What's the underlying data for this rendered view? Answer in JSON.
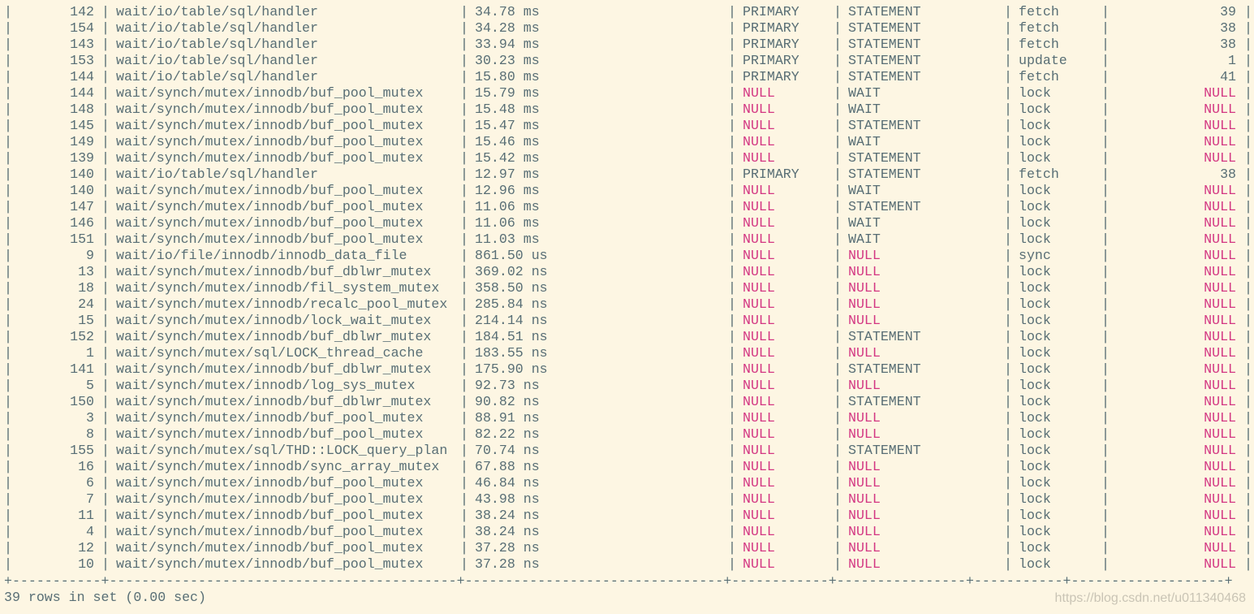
{
  "table": {
    "rows": [
      {
        "id": "142",
        "event": "wait/io/table/sql/handler",
        "latency": "34.78 ms",
        "index": "PRIMARY",
        "type": "STATEMENT",
        "op": "fetch",
        "rows": "39"
      },
      {
        "id": "154",
        "event": "wait/io/table/sql/handler",
        "latency": "34.28 ms",
        "index": "PRIMARY",
        "type": "STATEMENT",
        "op": "fetch",
        "rows": "38"
      },
      {
        "id": "143",
        "event": "wait/io/table/sql/handler",
        "latency": "33.94 ms",
        "index": "PRIMARY",
        "type": "STATEMENT",
        "op": "fetch",
        "rows": "38"
      },
      {
        "id": "153",
        "event": "wait/io/table/sql/handler",
        "latency": "30.23 ms",
        "index": "PRIMARY",
        "type": "STATEMENT",
        "op": "update",
        "rows": "1"
      },
      {
        "id": "144",
        "event": "wait/io/table/sql/handler",
        "latency": "15.80 ms",
        "index": "PRIMARY",
        "type": "STATEMENT",
        "op": "fetch",
        "rows": "41"
      },
      {
        "id": "144",
        "event": "wait/synch/mutex/innodb/buf_pool_mutex",
        "latency": "15.79 ms",
        "index": "NULL",
        "type": "WAIT",
        "op": "lock",
        "rows": "NULL"
      },
      {
        "id": "148",
        "event": "wait/synch/mutex/innodb/buf_pool_mutex",
        "latency": "15.48 ms",
        "index": "NULL",
        "type": "WAIT",
        "op": "lock",
        "rows": "NULL"
      },
      {
        "id": "145",
        "event": "wait/synch/mutex/innodb/buf_pool_mutex",
        "latency": "15.47 ms",
        "index": "NULL",
        "type": "STATEMENT",
        "op": "lock",
        "rows": "NULL"
      },
      {
        "id": "149",
        "event": "wait/synch/mutex/innodb/buf_pool_mutex",
        "latency": "15.46 ms",
        "index": "NULL",
        "type": "WAIT",
        "op": "lock",
        "rows": "NULL"
      },
      {
        "id": "139",
        "event": "wait/synch/mutex/innodb/buf_pool_mutex",
        "latency": "15.42 ms",
        "index": "NULL",
        "type": "STATEMENT",
        "op": "lock",
        "rows": "NULL"
      },
      {
        "id": "140",
        "event": "wait/io/table/sql/handler",
        "latency": "12.97 ms",
        "index": "PRIMARY",
        "type": "STATEMENT",
        "op": "fetch",
        "rows": "38"
      },
      {
        "id": "140",
        "event": "wait/synch/mutex/innodb/buf_pool_mutex",
        "latency": "12.96 ms",
        "index": "NULL",
        "type": "WAIT",
        "op": "lock",
        "rows": "NULL"
      },
      {
        "id": "147",
        "event": "wait/synch/mutex/innodb/buf_pool_mutex",
        "latency": "11.06 ms",
        "index": "NULL",
        "type": "STATEMENT",
        "op": "lock",
        "rows": "NULL"
      },
      {
        "id": "146",
        "event": "wait/synch/mutex/innodb/buf_pool_mutex",
        "latency": "11.06 ms",
        "index": "NULL",
        "type": "WAIT",
        "op": "lock",
        "rows": "NULL"
      },
      {
        "id": "151",
        "event": "wait/synch/mutex/innodb/buf_pool_mutex",
        "latency": "11.03 ms",
        "index": "NULL",
        "type": "WAIT",
        "op": "lock",
        "rows": "NULL"
      },
      {
        "id": "9",
        "event": "wait/io/file/innodb/innodb_data_file",
        "latency": "861.50 us",
        "index": "NULL",
        "type": "NULL",
        "op": "sync",
        "rows": "NULL"
      },
      {
        "id": "13",
        "event": "wait/synch/mutex/innodb/buf_dblwr_mutex",
        "latency": "369.02 ns",
        "index": "NULL",
        "type": "NULL",
        "op": "lock",
        "rows": "NULL"
      },
      {
        "id": "18",
        "event": "wait/synch/mutex/innodb/fil_system_mutex",
        "latency": "358.50 ns",
        "index": "NULL",
        "type": "NULL",
        "op": "lock",
        "rows": "NULL"
      },
      {
        "id": "24",
        "event": "wait/synch/mutex/innodb/recalc_pool_mutex",
        "latency": "285.84 ns",
        "index": "NULL",
        "type": "NULL",
        "op": "lock",
        "rows": "NULL"
      },
      {
        "id": "15",
        "event": "wait/synch/mutex/innodb/lock_wait_mutex",
        "latency": "214.14 ns",
        "index": "NULL",
        "type": "NULL",
        "op": "lock",
        "rows": "NULL"
      },
      {
        "id": "152",
        "event": "wait/synch/mutex/innodb/buf_dblwr_mutex",
        "latency": "184.51 ns",
        "index": "NULL",
        "type": "STATEMENT",
        "op": "lock",
        "rows": "NULL"
      },
      {
        "id": "1",
        "event": "wait/synch/mutex/sql/LOCK_thread_cache",
        "latency": "183.55 ns",
        "index": "NULL",
        "type": "NULL",
        "op": "lock",
        "rows": "NULL"
      },
      {
        "id": "141",
        "event": "wait/synch/mutex/innodb/buf_dblwr_mutex",
        "latency": "175.90 ns",
        "index": "NULL",
        "type": "STATEMENT",
        "op": "lock",
        "rows": "NULL"
      },
      {
        "id": "5",
        "event": "wait/synch/mutex/innodb/log_sys_mutex",
        "latency": "92.73 ns",
        "index": "NULL",
        "type": "NULL",
        "op": "lock",
        "rows": "NULL"
      },
      {
        "id": "150",
        "event": "wait/synch/mutex/innodb/buf_dblwr_mutex",
        "latency": "90.82 ns",
        "index": "NULL",
        "type": "STATEMENT",
        "op": "lock",
        "rows": "NULL"
      },
      {
        "id": "3",
        "event": "wait/synch/mutex/innodb/buf_pool_mutex",
        "latency": "88.91 ns",
        "index": "NULL",
        "type": "NULL",
        "op": "lock",
        "rows": "NULL"
      },
      {
        "id": "8",
        "event": "wait/synch/mutex/innodb/buf_pool_mutex",
        "latency": "82.22 ns",
        "index": "NULL",
        "type": "NULL",
        "op": "lock",
        "rows": "NULL"
      },
      {
        "id": "155",
        "event": "wait/synch/mutex/sql/THD::LOCK_query_plan",
        "latency": "70.74 ns",
        "index": "NULL",
        "type": "STATEMENT",
        "op": "lock",
        "rows": "NULL"
      },
      {
        "id": "16",
        "event": "wait/synch/mutex/innodb/sync_array_mutex",
        "latency": "67.88 ns",
        "index": "NULL",
        "type": "NULL",
        "op": "lock",
        "rows": "NULL"
      },
      {
        "id": "6",
        "event": "wait/synch/mutex/innodb/buf_pool_mutex",
        "latency": "46.84 ns",
        "index": "NULL",
        "type": "NULL",
        "op": "lock",
        "rows": "NULL"
      },
      {
        "id": "7",
        "event": "wait/synch/mutex/innodb/buf_pool_mutex",
        "latency": "43.98 ns",
        "index": "NULL",
        "type": "NULL",
        "op": "lock",
        "rows": "NULL"
      },
      {
        "id": "11",
        "event": "wait/synch/mutex/innodb/buf_pool_mutex",
        "latency": "38.24 ns",
        "index": "NULL",
        "type": "NULL",
        "op": "lock",
        "rows": "NULL"
      },
      {
        "id": "4",
        "event": "wait/synch/mutex/innodb/buf_pool_mutex",
        "latency": "38.24 ns",
        "index": "NULL",
        "type": "NULL",
        "op": "lock",
        "rows": "NULL"
      },
      {
        "id": "12",
        "event": "wait/synch/mutex/innodb/buf_pool_mutex",
        "latency": "37.28 ns",
        "index": "NULL",
        "type": "NULL",
        "op": "lock",
        "rows": "NULL"
      },
      {
        "id": "10",
        "event": "wait/synch/mutex/innodb/buf_pool_mutex",
        "latency": "37.28 ns",
        "index": "NULL",
        "type": "NULL",
        "op": "lock",
        "rows": "NULL"
      }
    ],
    "bottom_border": "+-----------+-------------------------------------------+--------------------------------+------------+----------------+-----------+-------------------+"
  },
  "footer": {
    "result_text": "39 rows in set (0.00 sec)"
  },
  "watermark": {
    "text": "https://blog.csdn.net/u011340468"
  },
  "colors": {
    "background": "#fdf6e3",
    "text": "#586e75",
    "null": "#d33682"
  }
}
